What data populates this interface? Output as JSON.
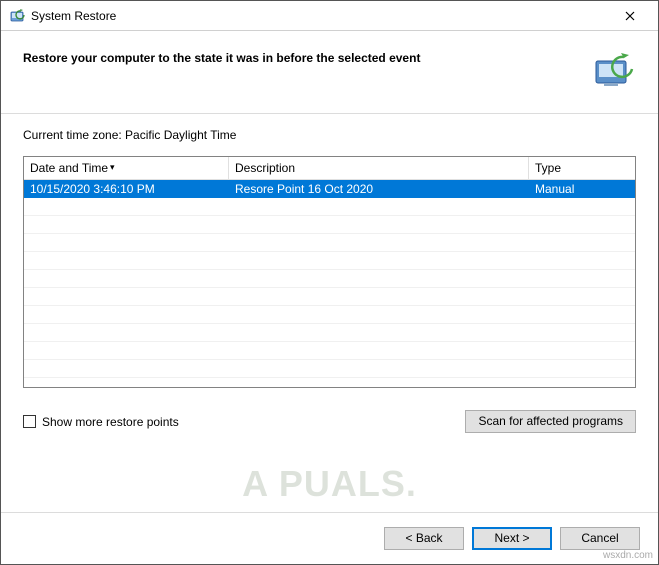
{
  "window": {
    "title": "System Restore"
  },
  "header": {
    "heading": "Restore your computer to the state it was in before the selected event"
  },
  "timezone": {
    "label": "Current time zone: Pacific Daylight Time"
  },
  "table": {
    "columns": {
      "datetime": "Date and Time",
      "description": "Description",
      "type": "Type"
    },
    "rows": [
      {
        "datetime": "10/15/2020 3:46:10 PM",
        "description": "Resore Point 16 Oct 2020",
        "type": "Manual",
        "selected": true
      }
    ]
  },
  "options": {
    "show_more_label": "Show more restore points",
    "scan_button": "Scan for affected programs"
  },
  "footer": {
    "back": "< Back",
    "next": "Next >",
    "cancel": "Cancel"
  },
  "watermark": {
    "main": "A  PUALS.",
    "corner": "wsxdn.com"
  }
}
